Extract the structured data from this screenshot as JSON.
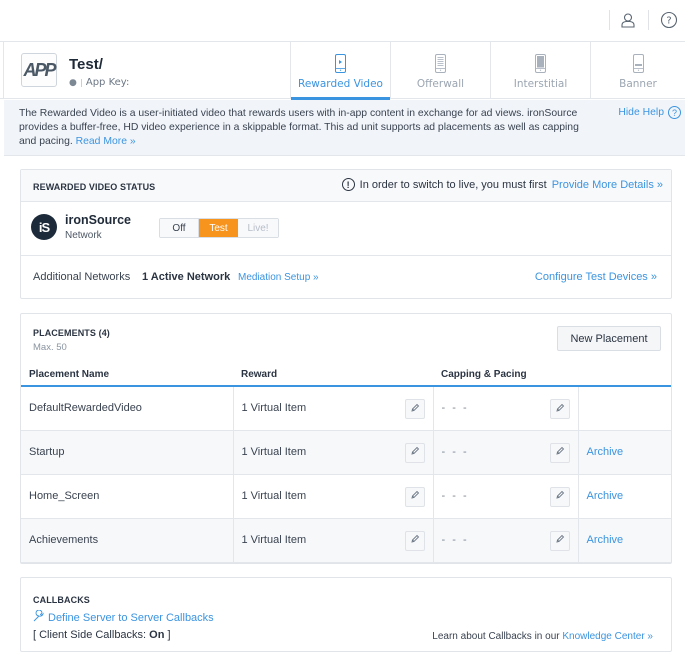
{
  "topbar": {
    "icons": [
      "user-icon",
      "help-icon"
    ]
  },
  "app": {
    "name": "Test/",
    "logo_text": "APP",
    "platform_icon": "apple-icon",
    "app_key_label": "App Key: "
  },
  "tabs": [
    {
      "label": "Rewarded Video",
      "icon": "rewarded-video-icon",
      "active": true
    },
    {
      "label": "Offerwall",
      "icon": "offerwall-icon",
      "active": false
    },
    {
      "label": "Interstitial",
      "icon": "interstitial-icon",
      "active": false
    },
    {
      "label": "Banner",
      "icon": "banner-icon",
      "active": false
    }
  ],
  "help": {
    "text": "The Rewarded Video is a user-initiated video that rewards users with in-app content in exchange for ad views. ironSource provides a buffer-free, HD video experience in a skippable format. This ad unit supports ad placements as well as capping and pacing.",
    "read_more": "Read More »",
    "hide_help": "Hide Help"
  },
  "status": {
    "title": "REWARDED VIDEO STATUS",
    "warning_text": "In order to switch to live, you must first",
    "warning_link": "Provide More Details »",
    "network_logo": "iS",
    "network_name": "ironSource",
    "network_sub": "Network",
    "toggle": {
      "off": "Off",
      "test": "Test",
      "live": "Live!",
      "selected": "Test"
    },
    "additional_label": "Additional Networks",
    "active_count": "1 Active Network",
    "mediation_link": "Mediation Setup »",
    "configure_link": "Configure Test Devices »"
  },
  "placements": {
    "title": "PLACEMENTS (4)",
    "max": "Max. 50",
    "new_button": "New Placement",
    "columns": [
      "Placement Name",
      "Reward",
      "Capping & Pacing",
      ""
    ],
    "rows": [
      {
        "name": "DefaultRewardedVideo",
        "reward": "1 Virtual Item",
        "capping": "- - -",
        "action": ""
      },
      {
        "name": "Startup",
        "reward": "1 Virtual Item",
        "capping": "- - -",
        "action": "Archive"
      },
      {
        "name": "Home_Screen",
        "reward": "1 Virtual Item",
        "capping": "- - -",
        "action": "Archive"
      },
      {
        "name": "Achievements",
        "reward": "1 Virtual Item",
        "capping": "- - -",
        "action": "Archive"
      }
    ]
  },
  "callbacks": {
    "title": "CALLBACKS",
    "define_link": "Define Server to Server Callbacks",
    "client_prefix": "[ Client Side Callbacks: ",
    "client_value": "On",
    "client_suffix": " ]",
    "learn_text": "Learn about Callbacks in our ",
    "learn_link": "Knowledge Center »"
  },
  "colors": {
    "accent": "#3b94e0",
    "test_orange": "#f7941d",
    "help_bg": "#f1f5fa"
  }
}
